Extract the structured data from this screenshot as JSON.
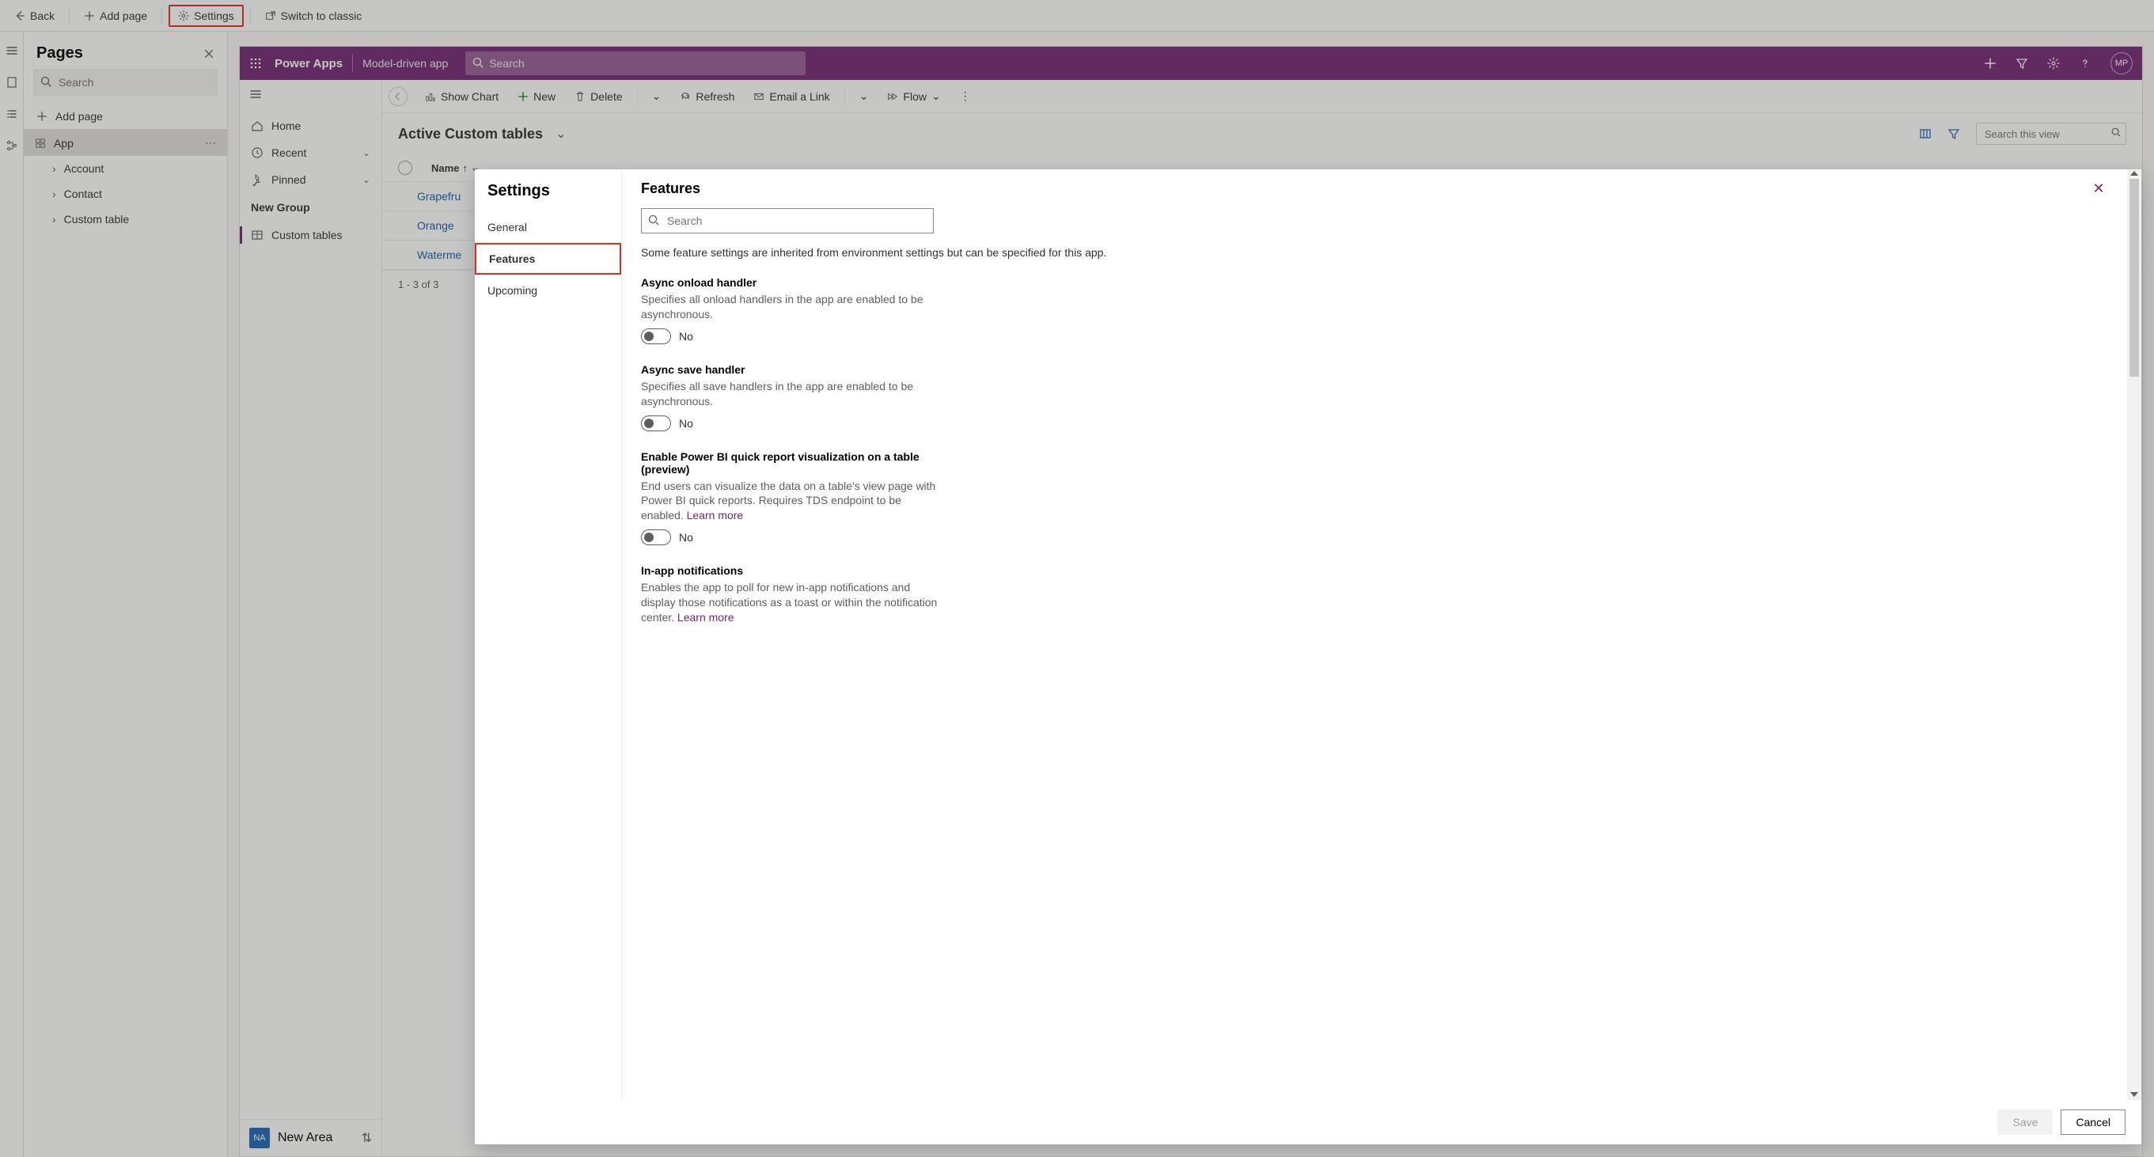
{
  "toolbar": {
    "back": "Back",
    "add_page": "Add page",
    "settings": "Settings",
    "switch": "Switch to classic"
  },
  "pages_panel": {
    "title": "Pages",
    "search_placeholder": "Search",
    "add_page": "Add page",
    "tree": {
      "app": "App",
      "account": "Account",
      "contact": "Contact",
      "custom": "Custom table"
    }
  },
  "app_shell": {
    "brand": "Power Apps",
    "app_name": "Model-driven app",
    "search_placeholder": "Search",
    "avatar": "MP",
    "nav": {
      "home": "Home",
      "recent": "Recent",
      "pinned": "Pinned",
      "group": "New Group",
      "custom_tables": "Custom tables",
      "area_badge": "NA",
      "area": "New Area"
    },
    "cmd": {
      "show_chart": "Show Chart",
      "new": "New",
      "delete": "Delete",
      "refresh": "Refresh",
      "email": "Email a Link",
      "flow": "Flow"
    },
    "view_title": "Active Custom tables",
    "view_search_placeholder": "Search this view",
    "col_name": "Name",
    "rows": [
      "Grapefru",
      "Orange",
      "Waterme"
    ],
    "status": "1 - 3 of 3"
  },
  "modal": {
    "title": "Settings",
    "nav": {
      "general": "General",
      "features": "Features",
      "upcoming": "Upcoming"
    },
    "features": {
      "heading": "Features",
      "search_placeholder": "Search",
      "intro": "Some feature settings are inherited from environment settings but can be specified for this app.",
      "items": [
        {
          "title": "Async onload handler",
          "desc": "Specifies all onload handlers in the app are enabled to be asynchronous.",
          "toggle": "No"
        },
        {
          "title": "Async save handler",
          "desc": "Specifies all save handlers in the app are enabled to be asynchronous.",
          "toggle": "No"
        },
        {
          "title": "Enable Power BI quick report visualization on a table (preview)",
          "desc": "End users can visualize the data on a table's view page with Power BI quick reports. Requires TDS endpoint to be enabled. ",
          "learn": "Learn more",
          "toggle": "No"
        },
        {
          "title": "In-app notifications",
          "desc": "Enables the app to poll for new in-app notifications and display those notifications as a toast or within the notification center. ",
          "learn": "Learn more"
        }
      ]
    },
    "save": "Save",
    "cancel": "Cancel"
  }
}
